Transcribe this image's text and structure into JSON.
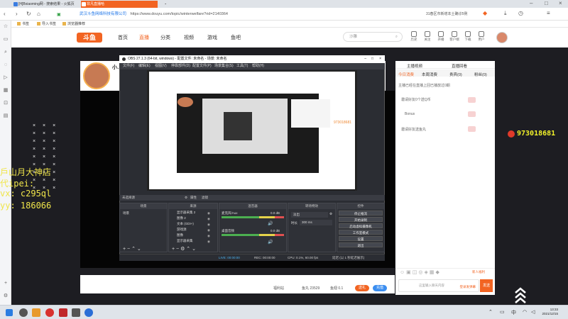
{
  "browser": {
    "tabs": [
      {
        "title": "[H]Bxiaoming网 - 搜索结果 - 火狐页",
        "active": false
      },
      {
        "title": "非凡直播哈",
        "active": true
      }
    ],
    "new_tab": "+",
    "security_text": "武汉斗鱼网络科技有限公司",
    "url": "https://www.douyu.com/topic/winterwelfare?rid=2140364",
    "weather": "31春区市新增本土确诊5例",
    "bookmarks": [
      "书签",
      "导入书签",
      "浏览器推荐"
    ]
  },
  "douyu": {
    "nav": [
      "首页",
      "直播",
      "分类",
      "视频",
      "游戏",
      "鱼吧"
    ],
    "search_placeholder": "沙雕",
    "header_icons": [
      "历史",
      "关注",
      "开播",
      "客户端",
      "下载",
      "用户"
    ],
    "streamer_name": "小…",
    "bottom_items": [
      "福利站",
      "鱼丸 23529",
      "鱼翅 0.1"
    ],
    "bottom_buttons": [
      "送礼",
      "充值"
    ]
  },
  "overlay": {
    "dots_rows": [
      "× × ×",
      "× × ×",
      "× × ×",
      "× × ×",
      "× × ×",
      "× × ×",
      "× × ×",
      "× × ×",
      "× × ×"
    ],
    "yellow_lines": [
      "戶山月大神店",
      "代ipei:",
      "vx: c295ql",
      "yy: 186066"
    ],
    "qq_number": "973018681"
  },
  "right_panel": {
    "tabs_top": [
      "主播视频",
      "直播回看"
    ],
    "tabs_sub": [
      "今日消费",
      "本周消费",
      "贵宾(0)",
      "粉丝(0)"
    ],
    "notice": "主播已经在直播上回已播放过0期",
    "rows": [
      "邀请好友0个送Q币",
      "Bonus",
      "邀请好友送鱼丸"
    ],
    "chat_placeholder": "这里输入聊天内容",
    "chat_hint": "登录发弹幕",
    "send": "发送",
    "promo_label": "新人福利"
  },
  "obs": {
    "title": "OBS 27.1.3 (64-bit, windows) - 配置文件: 未命名 - 场景: 未命名",
    "menu": [
      "文件(F)",
      "编辑(E)",
      "视图(V)",
      "停靠部件(D)",
      "配置文件(P)",
      "场景集合(S)",
      "工具(T)",
      "帮助(H)"
    ],
    "source_bar": [
      "未选择源",
      "属性",
      "滤镜"
    ],
    "docks": {
      "scenes": {
        "title": "场景",
        "items": [
          "场景"
        ]
      },
      "sources": {
        "title": "来源",
        "items": [
          "显示器采集 2",
          "图像 2",
          "文本 (GDI+)",
          "游戏源",
          "图像",
          "显示器采集"
        ]
      },
      "mixer": {
        "title": "混音器",
        "channels": [
          {
            "name": "麦克风/Aux",
            "db": "0.0 dB"
          },
          {
            "name": "桌面音频",
            "db": "0.0 dB"
          }
        ]
      },
      "transitions": {
        "title": "转场特效",
        "type": "淡出",
        "duration_label": "时长",
        "duration": "300 ms"
      },
      "controls": {
        "title": "控件",
        "buttons": [
          "停止推流",
          "开始录制",
          "启动虚拟摄像机",
          "工作室模式",
          "设置",
          "退出"
        ]
      }
    },
    "status": {
      "live": "LIVE: 00:00:00",
      "rec": "REC: 00:00:00",
      "cpu": "CPU: 0.1%, 60.00 fps",
      "kbps": "延迟 (以 1 秒延迟展示)"
    }
  },
  "taskbar": {
    "time": "13:33",
    "date": "2021/12/15"
  },
  "colors": {
    "douyu_orange": "#f26422",
    "overlay_yellow": "#f0e54a"
  }
}
